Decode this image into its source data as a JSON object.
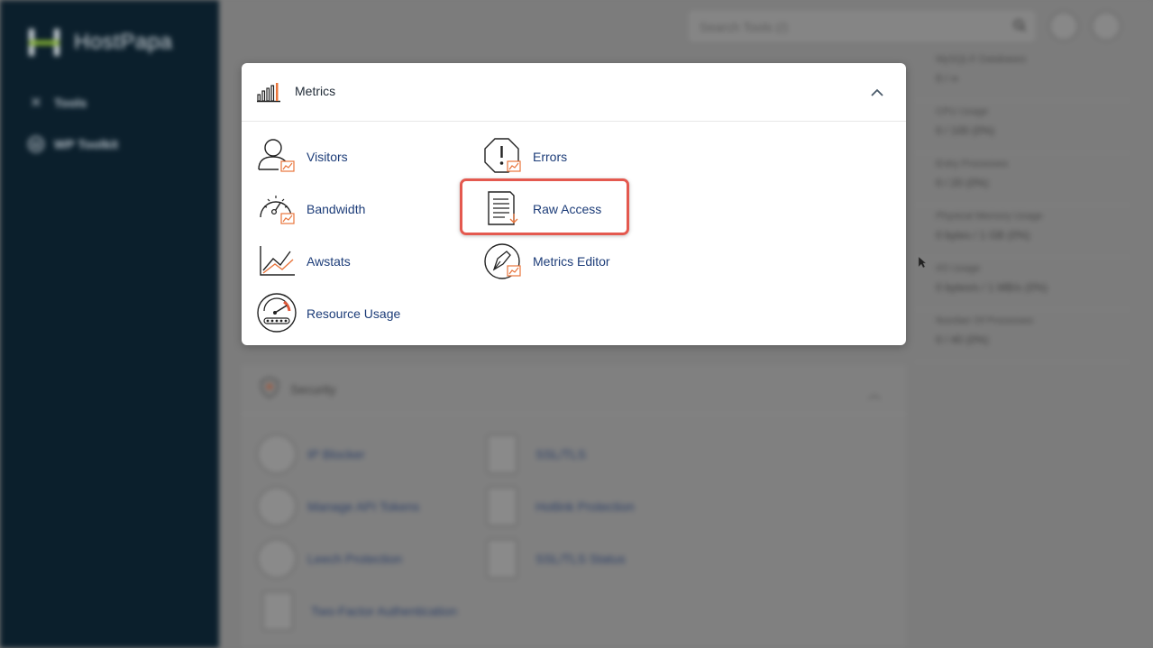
{
  "sidebar": {
    "brand": "HostPapa",
    "items": [
      {
        "label": "Tools",
        "icon": "tools-icon"
      },
      {
        "label": "WP Toolkit",
        "icon": "wordpress-icon"
      }
    ]
  },
  "header": {
    "search_placeholder": "Search Tools (/)",
    "search_icon": "search-icon",
    "buttons": [
      "user-icon",
      "account-icon"
    ]
  },
  "stats": [
    {
      "label": "MySQL® Databases",
      "value": "0 / ∞"
    },
    {
      "label": "CPU Usage",
      "value": "0 / 100   (0%)"
    },
    {
      "label": "Entry Processes",
      "value": "0 / 20   (0%)"
    },
    {
      "label": "Physical Memory Usage",
      "value": "0 bytes / 1 GB   (0%)"
    },
    {
      "label": "I/O Usage",
      "value": "0 bytes/s / 1 MB/s   (0%)"
    },
    {
      "label": "Number Of Processes",
      "value": "0 / 40   (0%)"
    }
  ],
  "metrics": {
    "title": "Metrics",
    "tools": [
      {
        "label": "Visitors",
        "icon": "visitors-icon"
      },
      {
        "label": "Errors",
        "icon": "errors-icon"
      },
      {
        "label": "Bandwidth",
        "icon": "bandwidth-icon"
      },
      {
        "label": "Raw Access",
        "icon": "raw-access-icon"
      },
      {
        "label": "Awstats",
        "icon": "awstats-icon"
      },
      {
        "label": "Metrics Editor",
        "icon": "metrics-editor-icon"
      },
      {
        "label": "Resource Usage",
        "icon": "resource-usage-icon"
      }
    ],
    "accent": "#e8743b",
    "highlight_color": "#e4594f"
  },
  "security": {
    "title": "Security",
    "tools": [
      {
        "label": "IP Blocker"
      },
      {
        "label": "SSL/TLS"
      },
      {
        "label": "Manage API Tokens"
      },
      {
        "label": "Hotlink Protection"
      },
      {
        "label": "Leech Protection"
      },
      {
        "label": "SSL/TLS Status"
      },
      {
        "label": "Two-Factor Authentication"
      }
    ]
  }
}
